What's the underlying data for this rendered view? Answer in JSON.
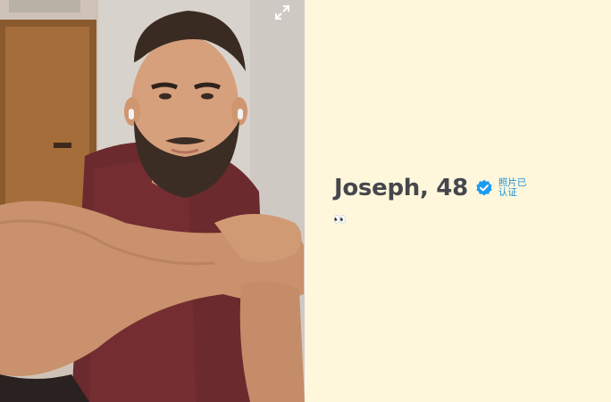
{
  "profile": {
    "name_age": "Joseph, 48",
    "verified_label": "照片已认证",
    "bio_emoji": "👀"
  },
  "icons": {
    "expand": "expand-icon",
    "verified": "verified-check-icon"
  },
  "colors": {
    "background": "#fff7dc",
    "name_text": "#45474d",
    "verified_blue": "#1d9bf0"
  }
}
